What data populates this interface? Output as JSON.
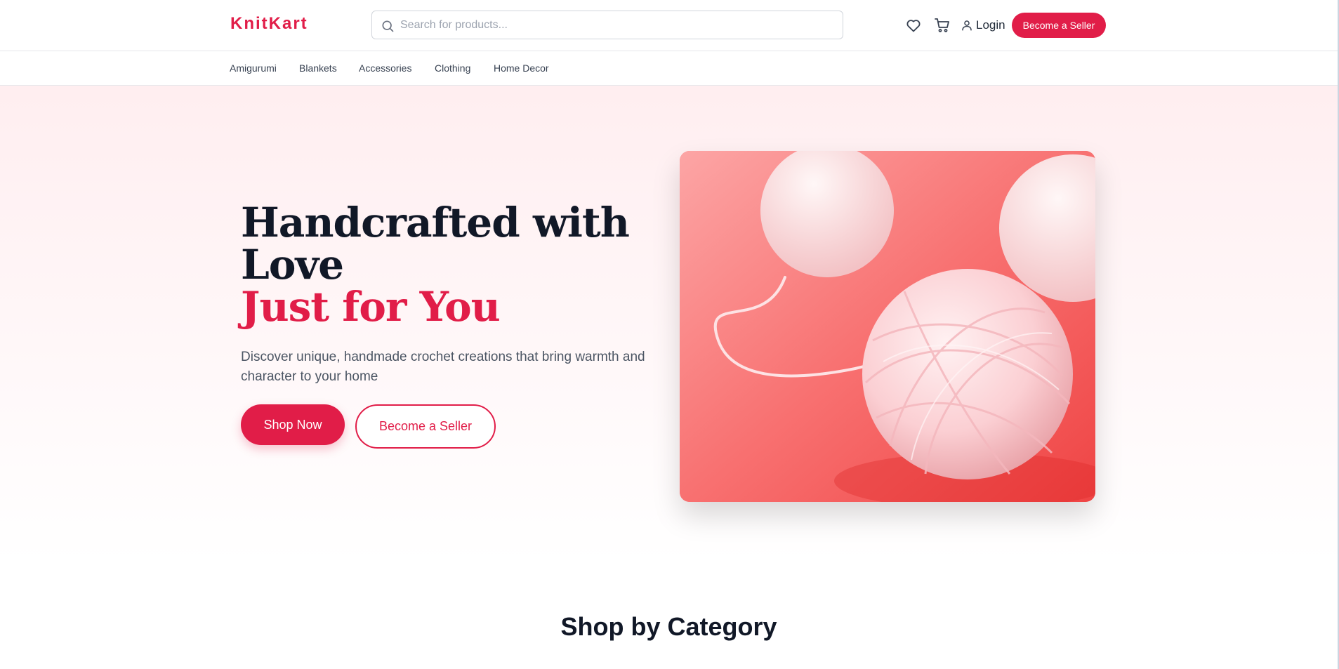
{
  "brand": {
    "logo": "KnitKart",
    "accent_color": "#e11d48"
  },
  "header": {
    "search_placeholder": "Search for products...",
    "icons": [
      "heart-icon",
      "cart-icon",
      "user-icon",
      "search-icon"
    ],
    "login_label": "Login",
    "seller_button_label": "Become a Seller"
  },
  "nav": {
    "items": [
      {
        "label": "Amigurumi"
      },
      {
        "label": "Blankets"
      },
      {
        "label": "Accessories"
      },
      {
        "label": "Clothing"
      },
      {
        "label": "Home Decor"
      }
    ]
  },
  "hero": {
    "title_line1": "Handcrafted with",
    "title_line2": "Love",
    "title_accent": "Just for You",
    "subtitle": "Discover unique, handmade crochet creations that bring warmth and character to your home",
    "primary_cta": "Shop Now",
    "secondary_cta": "Become a Seller"
  },
  "category_section": {
    "title": "Shop by Category"
  }
}
